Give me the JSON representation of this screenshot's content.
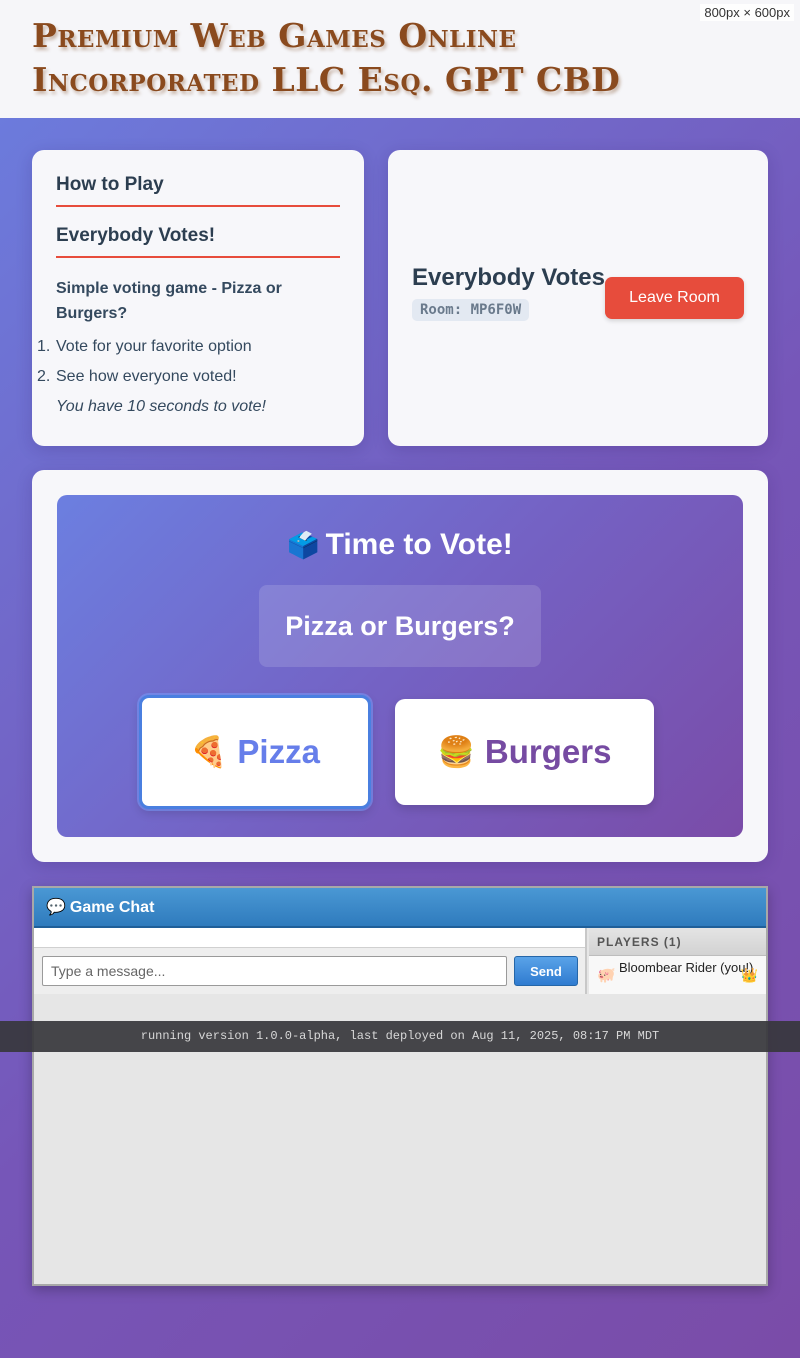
{
  "site": {
    "title": "Premium Web Games Online Incorporated LLC Esq. GPT CBD",
    "viewport_badge": "800px × 600px"
  },
  "how_to_play": {
    "heading": "How to Play",
    "game_name": "Everybody Votes!",
    "description": "Simple voting game - Pizza or Burgers?",
    "steps": [
      "Vote for your favorite option",
      "See how everyone voted!"
    ],
    "note": "You have 10 seconds to vote!"
  },
  "room": {
    "title": "Everybody Votes",
    "code_label": "Room: MP6F0W",
    "leave_label": "Leave Room"
  },
  "vote": {
    "heading": "Time to Vote!",
    "heading_icon": "🗳️",
    "question": "Pizza or Burgers?",
    "options": [
      {
        "icon": "🍕",
        "label": "Pizza",
        "color": "#667eea",
        "selected": true
      },
      {
        "icon": "🍔",
        "label": "Burgers",
        "color": "#764ba2",
        "selected": false
      }
    ]
  },
  "chat": {
    "heading": "Game Chat",
    "heading_icon": "💬",
    "input_placeholder": "Type a message...",
    "send_label": "Send",
    "players_heading": "PLAYERS (1)",
    "players": [
      {
        "avatar": "🐖",
        "name": "Bloombear Rider (you!)",
        "badge": "👑"
      }
    ]
  },
  "footer": {
    "version_text": "running version 1.0.0-alpha, last deployed on Aug 11, 2025, 08:17 PM MDT"
  },
  "colors": {
    "accent_red": "#e74c3c",
    "title_brown": "#8a4a1e",
    "chat_blue": "#2f7bbd"
  }
}
